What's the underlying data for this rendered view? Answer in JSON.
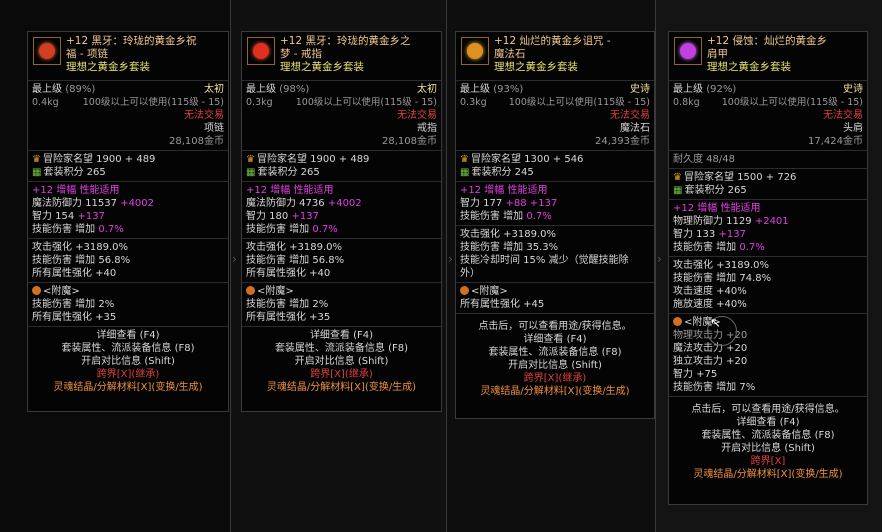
{
  "tooltips": [
    {
      "icon_color": "#d04020",
      "title_line1": "+12 黑牙：玲珑的黄金乡祝",
      "title_line2": "福 - 项链",
      "set_name": "理想之黄金乡套装",
      "grade_label": "最上级",
      "grade_pct": "(89%)",
      "rarity": "太初",
      "weight": "0.4kg",
      "level_req": "100级以上可以使用(115级 - 15)",
      "trade": "无法交易",
      "type": "项链",
      "price": "28,108金币",
      "fame": "冒险家名望 1900 + 489",
      "set_points": "套装积分 265",
      "amp_line": "+12 增幅 性能适用",
      "stat1_a": "魔法防御力 11537",
      "stat1_b": "+4002",
      "stat2_a": "智力 154",
      "stat2_b": "+137",
      "stat3_a": "技能伤害 增加",
      "stat3_b": "0.7%",
      "mod1": "攻击强化 +3189.0%",
      "mod2": "技能伤害 增加 56.8%",
      "mod3": "所有属性强化 +40",
      "ench_title": "<附魔>",
      "ench1": "技能伤害 增加 2%",
      "ench2": "所有属性强化 +35",
      "foot1": "详细查看 (F4)",
      "foot2": "套装属性、流派装备信息 (F8)",
      "foot3": "开启对比信息 (Shift)",
      "foot4": "跨界[X](继承)",
      "foot5": "灵魂结晶/分解材料[X](变换/生成)"
    },
    {
      "icon_color": "#e03020",
      "title_line1": "+12 黑牙：玲珑的黄金乡之",
      "title_line2": "梦 - 戒指",
      "set_name": "理想之黄金乡套装",
      "grade_label": "最上级",
      "grade_pct": "(98%)",
      "rarity": "太初",
      "weight": "0.3kg",
      "level_req": "100级以上可以使用(115级 - 15)",
      "trade": "无法交易",
      "type": "戒指",
      "price": "28,108金币",
      "fame": "冒险家名望 1900 + 489",
      "set_points": "套装积分 265",
      "amp_line": "+12 增幅 性能适用",
      "stat1_a": "魔法防御力 4736",
      "stat1_b": "+4002",
      "stat2_a": "智力 180",
      "stat2_b": "+137",
      "stat3_a": "技能伤害 增加",
      "stat3_b": "0.7%",
      "mod1": "攻击强化 +3189.0%",
      "mod2": "技能伤害 增加 56.8%",
      "mod3": "所有属性强化 +40",
      "ench_title": "<附魔>",
      "ench1": "技能伤害 增加 2%",
      "ench2": "所有属性强化 +35",
      "foot1": "详细查看 (F4)",
      "foot2": "套装属性、流派装备信息 (F8)",
      "foot3": "开启对比信息 (Shift)",
      "foot4": "跨界[X](继承)",
      "foot5": "灵魂结晶/分解材料[X](变换/生成)"
    },
    {
      "icon_color": "#e09020",
      "title_line1": "+12 灿烂的黄金乡诅咒 -",
      "title_line2": "魔法石",
      "set_name": "理想之黄金乡套装",
      "grade_label": "最上级",
      "grade_pct": "(93%)",
      "rarity": "史诗",
      "weight": "0.3kg",
      "level_req": "100级以上可以使用(115级 - 15)",
      "trade": "无法交易",
      "type": "魔法石",
      "price": "24,393金币",
      "fame": "冒险家名望 1300 + 546",
      "set_points": "套装积分 245",
      "amp_line": "+12 增幅 性能适用",
      "stat1_a": "智力 177",
      "stat1_b": "+88",
      "stat1_c": "+137",
      "stat3_a": "技能伤害 增加",
      "stat3_b": "0.7%",
      "mod1": "攻击强化 +3189.0%",
      "mod2": "技能伤害 增加 35.3%",
      "mod3": "技能冷却时间 15% 减少（觉醒技能除",
      "mod3b": "外）",
      "ench_title": "<附魔>",
      "ench1": "所有属性强化 +45",
      "foot0": "点击后，可以查看用途/获得信息。",
      "foot1": "详细查看 (F4)",
      "foot2": "套装属性、流派装备信息 (F8)",
      "foot3": "开启对比信息 (Shift)",
      "foot4": "跨界[X](继承)",
      "foot5": "灵魂结晶/分解材料[X](变换/生成)"
    },
    {
      "icon_color": "#c040e0",
      "title_line1": "+12 侵蚀：灿烂的黄金乡",
      "title_line2": "肩甲",
      "set_name": "理想之黄金乡套装",
      "grade_label": "最上级",
      "grade_pct": "(92%)",
      "rarity": "史诗",
      "weight": "0.8kg",
      "level_req": "100级以上可以使用(115级 - 15)",
      "trade": "无法交易",
      "type": "头肩",
      "price": "17,424金币",
      "durability": "耐久度 48/48",
      "fame": "冒险家名望 1500 + 726",
      "set_points": "套装积分 265",
      "amp_line": "+12 增幅 性能适用",
      "stat1_a": "物理防御力 1129",
      "stat1_b": "+2401",
      "stat2_a": "智力 133",
      "stat2_b": "+137",
      "stat3_a": "技能伤害 增加",
      "stat3_b": "0.7%",
      "mod1": "攻击强化 +3189.0%",
      "mod2": "技能伤害 增加 74.8%",
      "mod3": "攻击速度 +40%",
      "mod3b": "施放速度 +40%",
      "ench_title": "<附魔>",
      "ench0": "物理攻击力 +20",
      "ench0b": "魔法攻击力 +20",
      "ench0c": "独立攻击力 +20",
      "ench0d": "智力 +75",
      "ench1": "技能伤害 增加 7%",
      "foot0": "点击后，可以查看用途/获得信息。",
      "foot1": "详细查看 (F4)",
      "foot2": "套装属性、流派装备信息 (F8)",
      "foot3": "开启对比信息 (Shift)",
      "foot4": "跨界[X]",
      "foot5": "灵魂结晶/分解材料[X](变换/生成)"
    }
  ]
}
